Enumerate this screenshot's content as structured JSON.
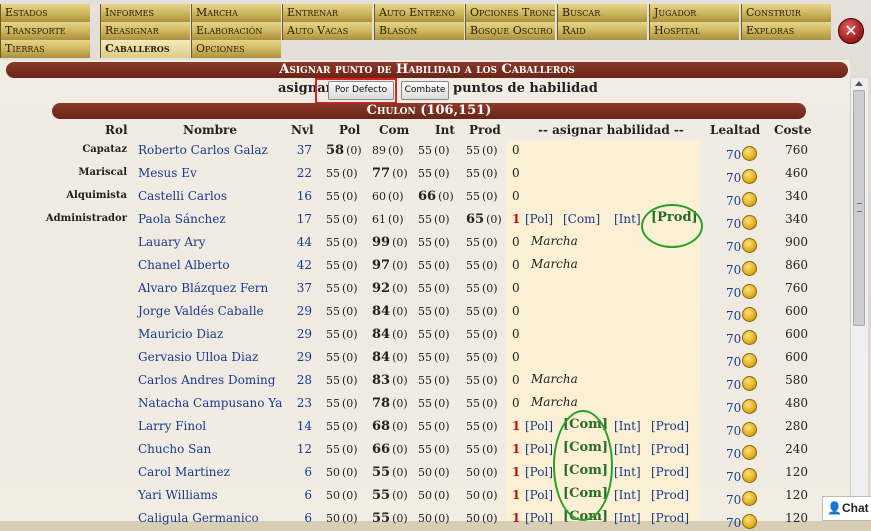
{
  "menu": {
    "row1": [
      "Estados",
      "Informes",
      "Marcha",
      "Entrenar",
      "Auto Entreno",
      "Opciones Tronco",
      "Buscar",
      "Jugador",
      "Construir"
    ],
    "row2": [
      "Transporte",
      "Reasignar",
      "Elaboración",
      "Auto Vacas",
      "Blasón",
      "Bosque Oscuro",
      "Raid",
      "Hospital",
      "Exploras"
    ],
    "row3": [
      "Tierras",
      "Caballeros",
      "Opciones"
    ],
    "selected": "Caballeros"
  },
  "close_icon": "close-x-icon",
  "title": "Asignar punto de Habilidad a los Caballeros",
  "assign": {
    "prefix": "asignar",
    "suffix": "puntos de habilidad",
    "btn_default": "Por Defecto",
    "btn_combat": "Combate"
  },
  "city": "Chulon (106,151)",
  "headers": {
    "rol": "Rol",
    "nombre": "Nombre",
    "nvl": "Nvl",
    "pol": "Pol",
    "com": "Com",
    "int": "Int",
    "prod": "Prod",
    "asignar": "-- asignar habilidad --",
    "lealtad": "Lealtad",
    "coste": "Coste"
  },
  "assign_links": {
    "pol": "[Pol]",
    "com": "[Com]",
    "int": "[Int]",
    "prod": "[Prod]"
  },
  "knights": [
    {
      "rol": "Capataz",
      "name": "Roberto Carlos Galaz",
      "lvl": "37",
      "pol": "58",
      "polp": "(0)",
      "com": "89",
      "comp": "(0)",
      "int": "55",
      "intp": "(0)",
      "prod": "55",
      "prodp": "(0)",
      "pts": "0",
      "status": "",
      "loy": "70",
      "cost": "760",
      "hi": "pol"
    },
    {
      "rol": "Mariscal",
      "name": "Mesus Ev",
      "lvl": "22",
      "pol": "55",
      "polp": "(0)",
      "com": "77",
      "comp": "(0)",
      "int": "55",
      "intp": "(0)",
      "prod": "55",
      "prodp": "(0)",
      "pts": "0",
      "status": "",
      "loy": "70",
      "cost": "460",
      "hi": "com"
    },
    {
      "rol": "Alquimista",
      "name": "Castelli Carlos",
      "lvl": "16",
      "pol": "55",
      "polp": "(0)",
      "com": "60",
      "comp": "(0)",
      "int": "66",
      "intp": "(0)",
      "prod": "55",
      "prodp": "(0)",
      "pts": "0",
      "status": "",
      "loy": "70",
      "cost": "340",
      "hi": "int"
    },
    {
      "rol": "Administrador",
      "name": "Paola Sánchez",
      "lvl": "17",
      "pol": "55",
      "polp": "(0)",
      "com": "61",
      "comp": "(0)",
      "int": "55",
      "intp": "(0)",
      "prod": "65",
      "prodp": "(0)",
      "pts": "1",
      "status": "links",
      "loy": "70",
      "cost": "340",
      "hi": "prod"
    },
    {
      "rol": "",
      "name": "Lauary Ary",
      "lvl": "44",
      "pol": "55",
      "polp": "(0)",
      "com": "99",
      "comp": "(0)",
      "int": "55",
      "intp": "(0)",
      "prod": "55",
      "prodp": "(0)",
      "pts": "0",
      "status": "Marcha",
      "loy": "70",
      "cost": "900",
      "hi": "com"
    },
    {
      "rol": "",
      "name": "Chanel Alberto",
      "lvl": "42",
      "pol": "55",
      "polp": "(0)",
      "com": "97",
      "comp": "(0)",
      "int": "55",
      "intp": "(0)",
      "prod": "55",
      "prodp": "(0)",
      "pts": "0",
      "status": "Marcha",
      "loy": "70",
      "cost": "860",
      "hi": "com"
    },
    {
      "rol": "",
      "name": "Alvaro Blázquez Fern",
      "lvl": "37",
      "pol": "55",
      "polp": "(0)",
      "com": "92",
      "comp": "(0)",
      "int": "55",
      "intp": "(0)",
      "prod": "55",
      "prodp": "(0)",
      "pts": "0",
      "status": "",
      "loy": "70",
      "cost": "760",
      "hi": "com"
    },
    {
      "rol": "",
      "name": "Jorge Valdés Caballe",
      "lvl": "29",
      "pol": "55",
      "polp": "(0)",
      "com": "84",
      "comp": "(0)",
      "int": "55",
      "intp": "(0)",
      "prod": "55",
      "prodp": "(0)",
      "pts": "0",
      "status": "",
      "loy": "70",
      "cost": "600",
      "hi": "com"
    },
    {
      "rol": "",
      "name": "Mauricio Diaz",
      "lvl": "29",
      "pol": "55",
      "polp": "(0)",
      "com": "84",
      "comp": "(0)",
      "int": "55",
      "intp": "(0)",
      "prod": "55",
      "prodp": "(0)",
      "pts": "0",
      "status": "",
      "loy": "70",
      "cost": "600",
      "hi": "com"
    },
    {
      "rol": "",
      "name": "Gervasio Ulloa Diaz",
      "lvl": "29",
      "pol": "55",
      "polp": "(0)",
      "com": "84",
      "comp": "(0)",
      "int": "55",
      "intp": "(0)",
      "prod": "55",
      "prodp": "(0)",
      "pts": "0",
      "status": "",
      "loy": "70",
      "cost": "600",
      "hi": "com"
    },
    {
      "rol": "",
      "name": "Carlos Andres Doming",
      "lvl": "28",
      "pol": "55",
      "polp": "(0)",
      "com": "83",
      "comp": "(0)",
      "int": "55",
      "intp": "(0)",
      "prod": "55",
      "prodp": "(0)",
      "pts": "0",
      "status": "Marcha",
      "loy": "70",
      "cost": "580",
      "hi": "com"
    },
    {
      "rol": "",
      "name": "Natacha Campusano Ya",
      "lvl": "23",
      "pol": "55",
      "polp": "(0)",
      "com": "78",
      "comp": "(0)",
      "int": "55",
      "intp": "(0)",
      "prod": "55",
      "prodp": "(0)",
      "pts": "0",
      "status": "Marcha",
      "loy": "70",
      "cost": "480",
      "hi": "com"
    },
    {
      "rol": "",
      "name": "Larry Finol",
      "lvl": "14",
      "pol": "55",
      "polp": "(0)",
      "com": "68",
      "comp": "(0)",
      "int": "55",
      "intp": "(0)",
      "prod": "55",
      "prodp": "(0)",
      "pts": "1",
      "status": "links",
      "loy": "70",
      "cost": "280",
      "hi": "com"
    },
    {
      "rol": "",
      "name": "Chucho San",
      "lvl": "12",
      "pol": "55",
      "polp": "(0)",
      "com": "66",
      "comp": "(0)",
      "int": "55",
      "intp": "(0)",
      "prod": "55",
      "prodp": "(0)",
      "pts": "1",
      "status": "links",
      "loy": "70",
      "cost": "240",
      "hi": "com"
    },
    {
      "rol": "",
      "name": "Carol Martinez",
      "lvl": "6",
      "pol": "50",
      "polp": "(0)",
      "com": "55",
      "comp": "(0)",
      "int": "50",
      "intp": "(0)",
      "prod": "50",
      "prodp": "(0)",
      "pts": "1",
      "status": "links",
      "loy": "70",
      "cost": "120",
      "hi": "com"
    },
    {
      "rol": "",
      "name": "Yari Williams",
      "lvl": "6",
      "pol": "50",
      "polp": "(0)",
      "com": "55",
      "comp": "(0)",
      "int": "50",
      "intp": "(0)",
      "prod": "50",
      "prodp": "(0)",
      "pts": "1",
      "status": "links",
      "loy": "70",
      "cost": "120",
      "hi": "com"
    },
    {
      "rol": "",
      "name": "Caligula Germanico",
      "lvl": "6",
      "pol": "50",
      "polp": "(0)",
      "com": "55",
      "comp": "(0)",
      "int": "50",
      "intp": "(0)",
      "prod": "50",
      "prodp": "(0)",
      "pts": "1",
      "status": "links",
      "loy": "70",
      "cost": "120",
      "hi": "com"
    }
  ],
  "chat_label": "Chat",
  "coin_icon": "gold-coin-icon",
  "colors": {
    "banner": "#7a2e20",
    "menu_gold": "#cbb35a",
    "link_blue": "#1a3a8a",
    "annotation_red": "#e02020",
    "annotation_green": "#2aa02a"
  }
}
